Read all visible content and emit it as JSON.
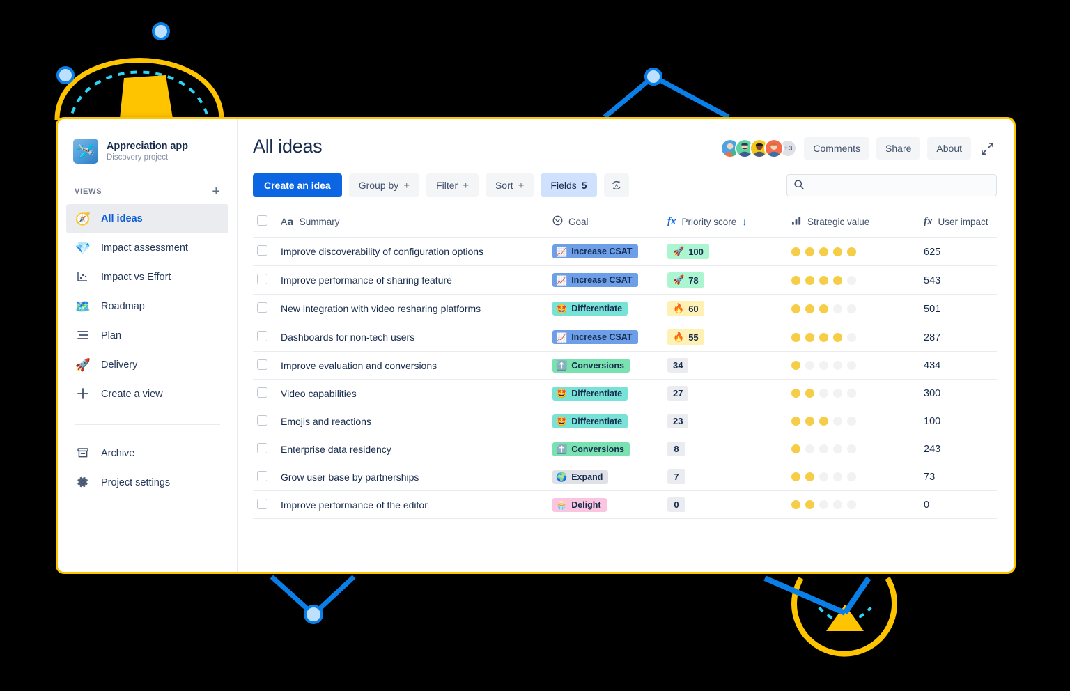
{
  "sidebar": {
    "project": {
      "name": "Appreciation app",
      "subtitle": "Discovery project",
      "logo_icon": "rocket-plane-icon"
    },
    "views_label": "VIEWS",
    "add_view_icon": "+",
    "items": [
      {
        "label": "All ideas",
        "icon": "compass-icon",
        "emoji": "🧭",
        "active": true
      },
      {
        "label": "Impact assessment",
        "icon": "diamond-icon",
        "emoji": "💎",
        "active": false
      },
      {
        "label": "Impact vs Effort",
        "icon": "scatter-chart-icon",
        "emoji": "",
        "active": false
      },
      {
        "label": "Roadmap",
        "icon": "map-icon",
        "emoji": "🗺️",
        "active": false
      },
      {
        "label": "Plan",
        "icon": "plan-lines-icon",
        "emoji": "",
        "active": false
      },
      {
        "label": "Delivery",
        "icon": "rocket-icon",
        "emoji": "🚀",
        "active": false
      },
      {
        "label": "Create a view",
        "icon": "plus-icon",
        "emoji": "",
        "active": false
      }
    ],
    "bottom_items": [
      {
        "label": "Archive",
        "icon": "archive-icon"
      },
      {
        "label": "Project settings",
        "icon": "gear-icon"
      }
    ]
  },
  "header": {
    "title": "All ideas",
    "avatars_overflow": "+3",
    "buttons": [
      {
        "label": "Comments",
        "name": "comments-button"
      },
      {
        "label": "Share",
        "name": "share-button"
      },
      {
        "label": "About",
        "name": "about-button"
      }
    ],
    "expand_icon": "expand-diagonal-icon"
  },
  "toolbar": {
    "create_label": "Create an idea",
    "group_by_label": "Group by",
    "group_by_plus": "+",
    "filter_label": "Filter",
    "filter_plus": "+",
    "sort_label": "Sort",
    "sort_plus": "+",
    "fields_label": "Fields",
    "fields_count": "5",
    "refresh_icon": "auto-sync-icon",
    "search": {
      "value": "",
      "placeholder": "",
      "icon": "search-icon"
    }
  },
  "table": {
    "columns": [
      {
        "key": "summary",
        "label": "Summary",
        "icon": "text-aa-icon"
      },
      {
        "key": "goal",
        "label": "Goal",
        "icon": "select-circle-icon"
      },
      {
        "key": "priority",
        "label": "Priority score",
        "icon": "fx-icon",
        "sorted": "desc",
        "sort_icon": "↓"
      },
      {
        "key": "strategic",
        "label": "Strategic value",
        "icon": "bar-chart-icon"
      },
      {
        "key": "impact",
        "label": "User impact",
        "icon": "fx-icon"
      }
    ],
    "goal_styles": {
      "Increase CSAT": {
        "bg": "#6C9FE8",
        "fg": "#172B4D",
        "emoji": "📈"
      },
      "Differentiate": {
        "bg": "#79E2D6",
        "fg": "#172B4D",
        "emoji": "🤩"
      },
      "Conversions": {
        "bg": "#79E2B0",
        "fg": "#172B4D",
        "emoji": "⬆️"
      },
      "Expand": {
        "bg": "#DFE1E6",
        "fg": "#172B4D",
        "emoji": "🌍"
      },
      "Delight": {
        "bg": "#FBC5E0",
        "fg": "#172B4D",
        "emoji": "🧁"
      }
    },
    "rows": [
      {
        "summary": "Improve discoverability of configuration options",
        "goal": "Increase CSAT",
        "priority": "100",
        "priority_style": "rocket",
        "priority_emoji": "🚀",
        "strategic": 5,
        "impact": "625"
      },
      {
        "summary": "Improve performance of sharing feature",
        "goal": "Increase CSAT",
        "priority": "78",
        "priority_style": "rocket",
        "priority_emoji": "🚀",
        "strategic": 4,
        "impact": "543"
      },
      {
        "summary": "New integration with video resharing platforms",
        "goal": "Differentiate",
        "priority": "60",
        "priority_style": "fire",
        "priority_emoji": "🔥",
        "strategic": 3,
        "impact": "501"
      },
      {
        "summary": "Dashboards for non-tech users",
        "goal": "Increase CSAT",
        "priority": "55",
        "priority_style": "fire",
        "priority_emoji": "🔥",
        "strategic": 4,
        "impact": "287"
      },
      {
        "summary": "Improve evaluation and conversions",
        "goal": "Conversions",
        "priority": "34",
        "priority_style": "plain",
        "priority_emoji": "",
        "strategic": 1,
        "impact": "434"
      },
      {
        "summary": "Video capabilities",
        "goal": "Differentiate",
        "priority": "27",
        "priority_style": "plain",
        "priority_emoji": "",
        "strategic": 2,
        "impact": "300"
      },
      {
        "summary": "Emojis and reactions",
        "goal": "Differentiate",
        "priority": "23",
        "priority_style": "plain",
        "priority_emoji": "",
        "strategic": 3,
        "impact": "100"
      },
      {
        "summary": "Enterprise data residency",
        "goal": "Conversions",
        "priority": "8",
        "priority_style": "plain",
        "priority_emoji": "",
        "strategic": 1,
        "impact": "243"
      },
      {
        "summary": "Grow user base by partnerships",
        "goal": "Expand",
        "priority": "7",
        "priority_style": "plain",
        "priority_emoji": "",
        "strategic": 2,
        "impact": "73"
      },
      {
        "summary": "Improve performance of the editor",
        "goal": "Delight",
        "priority": "0",
        "priority_style": "plain",
        "priority_emoji": "",
        "strategic": 2,
        "impact": "0"
      }
    ],
    "strategic_max": 5
  },
  "colors": {
    "accent_blue": "#0C66E4",
    "window_border": "#FFC400",
    "decor_yellow": "#FFC400",
    "decor_blue": "#0B7FE8",
    "decor_cyan": "#2DD4F5",
    "dot_on": "#F5CD47",
    "dot_off": "#F1F2F4",
    "background": "#000000"
  }
}
